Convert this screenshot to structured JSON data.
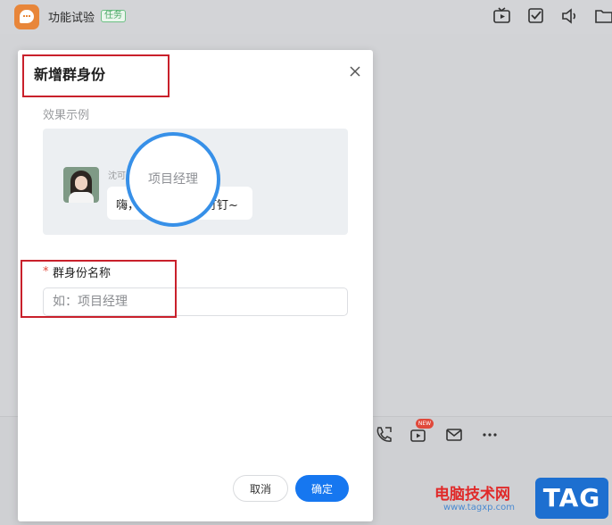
{
  "header": {
    "chat_title": "功能试验",
    "task_badge": "任务",
    "icons": [
      "tv-icon",
      "checkbox-icon",
      "speaker-icon",
      "folder-icon"
    ]
  },
  "toolbar": {
    "icons": [
      "phone-icon",
      "live-video-icon",
      "mail-icon",
      "more-icon"
    ],
    "new_badge": "NEW"
  },
  "dialog": {
    "title": "新增群身份",
    "example_label": "效果示例",
    "preview": {
      "sender_name": "沈可",
      "message_left": "嗨，",
      "message_right": "钉钉~",
      "magnified_tag": "项目经理"
    },
    "field_label": "群身份名称",
    "required_mark": "*",
    "input_value": "",
    "input_placeholder": "如：项目经理",
    "cancel_label": "取消",
    "confirm_label": "确定"
  },
  "watermark": {
    "site_name": "电脑技术网",
    "url": "www.tagxp.com",
    "tag": "TAG"
  },
  "colors": {
    "accent": "#1677f0",
    "highlight": "#c9202b",
    "required": "#e2483a"
  }
}
